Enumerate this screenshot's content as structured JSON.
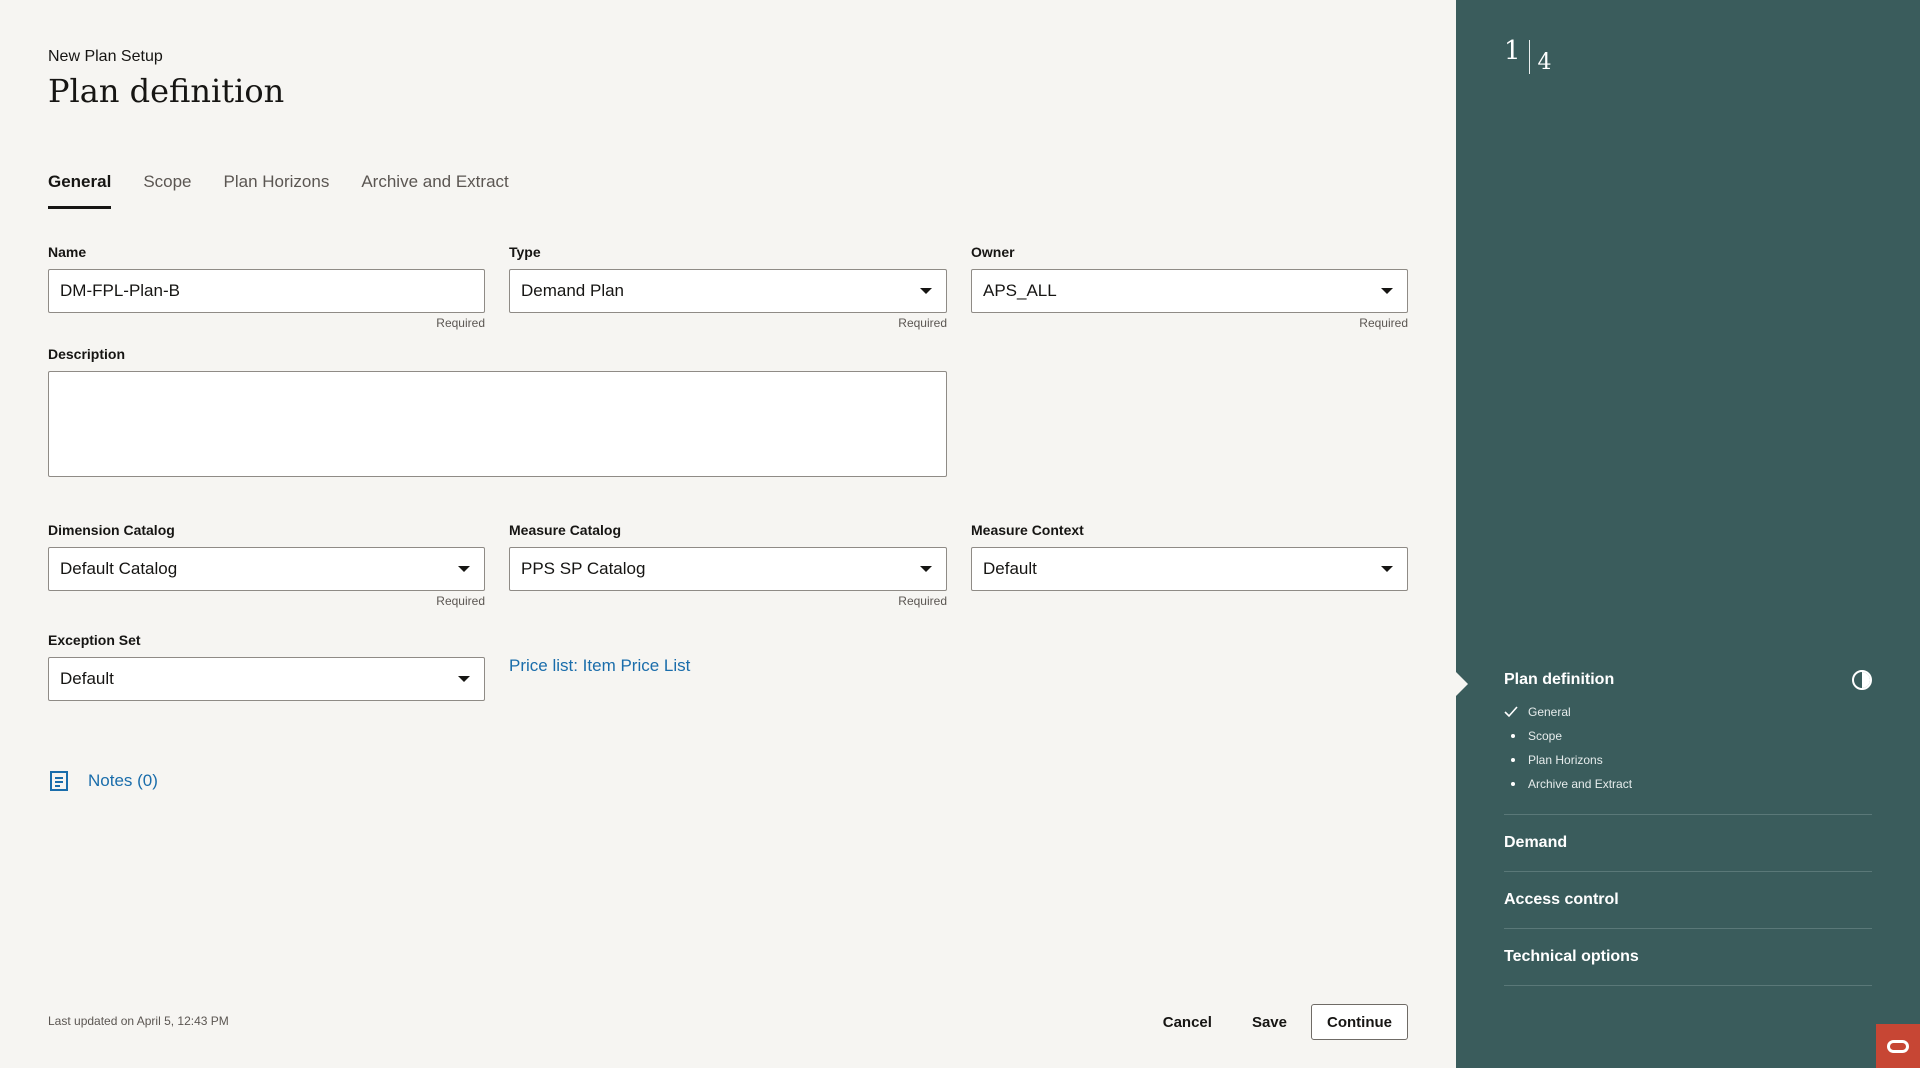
{
  "header": {
    "eyebrow": "New Plan Setup",
    "title": "Plan definition"
  },
  "tabs": [
    {
      "label": "General",
      "active": true
    },
    {
      "label": "Scope",
      "active": false
    },
    {
      "label": "Plan Horizons",
      "active": false
    },
    {
      "label": "Archive and Extract",
      "active": false
    }
  ],
  "form": {
    "name": {
      "label": "Name",
      "value": "DM-FPL-Plan-B",
      "hint": "Required"
    },
    "type": {
      "label": "Type",
      "value": "Demand Plan",
      "hint": "Required"
    },
    "owner": {
      "label": "Owner",
      "value": "APS_ALL",
      "hint": "Required"
    },
    "description": {
      "label": "Description",
      "value": ""
    },
    "dimension_catalog": {
      "label": "Dimension Catalog",
      "value": "Default Catalog",
      "hint": "Required"
    },
    "measure_catalog": {
      "label": "Measure Catalog",
      "value": "PPS SP Catalog",
      "hint": "Required"
    },
    "measure_context": {
      "label": "Measure Context",
      "value": "Default"
    },
    "exception_set": {
      "label": "Exception Set",
      "value": "Default"
    },
    "price_list_link": "Price list: Item Price List"
  },
  "notes": {
    "label": "Notes (0)",
    "icon": "notes-icon"
  },
  "footer": {
    "last_updated": "Last updated on April 5, 12:43 PM",
    "cancel": "Cancel",
    "save": "Save",
    "continue": "Continue"
  },
  "side": {
    "step_current": "1",
    "step_total": "4",
    "current_section": {
      "title": "Plan definition",
      "icon": "half-contrast-icon",
      "items": [
        {
          "label": "General",
          "state": "done"
        },
        {
          "label": "Scope",
          "state": "pending"
        },
        {
          "label": "Plan Horizons",
          "state": "pending"
        },
        {
          "label": "Archive and Extract",
          "state": "pending"
        }
      ]
    },
    "sections": [
      "Demand",
      "Access control",
      "Technical options"
    ]
  },
  "colors": {
    "background": "#f6f5f2",
    "side_panel": "#3a5c5c",
    "link": "#1a6dab",
    "oracle_badge": "#c74634"
  }
}
